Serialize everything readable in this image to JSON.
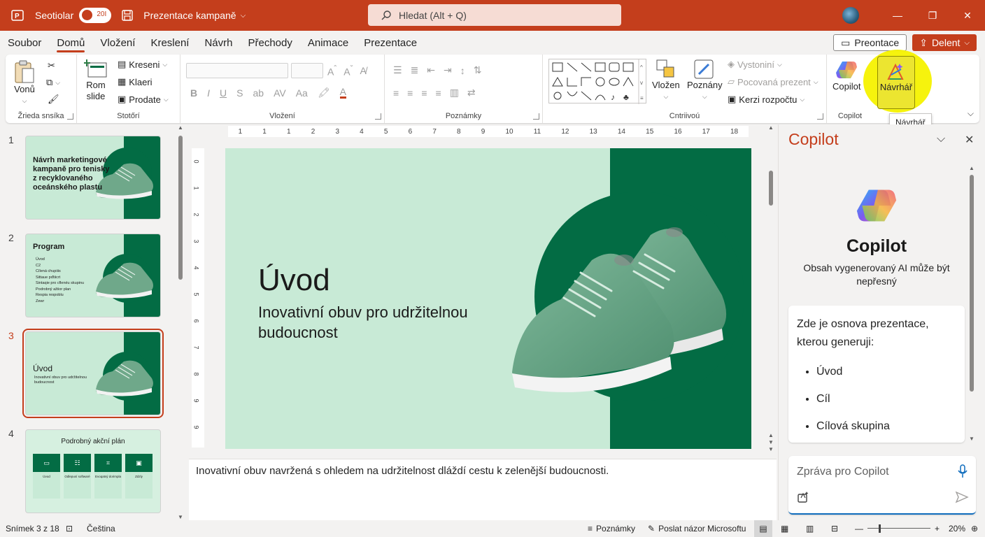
{
  "titlebar": {
    "autosave_label": "Seotiolar",
    "toggle_label": "20І",
    "doc_title": "Prezentace kampaně",
    "search_placeholder": "Hledat (Alt + Q)"
  },
  "menu": {
    "items": [
      "Soubor",
      "Domů",
      "Vložení",
      "Kreslení",
      "Návrh",
      "Přechody",
      "Animace",
      "Prezentace"
    ],
    "active": "Domů",
    "present_button": "Preontace",
    "share_button": "Delent"
  },
  "ribbon": {
    "groups": {
      "clipboard": {
        "label": "Žrieda snsíka",
        "paste": "Vonů"
      },
      "slides": {
        "label": "Stotőrí",
        "new_slide_line1": "Rom",
        "new_slide_line2": "slide",
        "layout": "Kreseni",
        "reset": "Klaeri",
        "section": "Prodate"
      },
      "font": {
        "label": "Vložení"
      },
      "paragraph": {
        "label": "Poznámky"
      },
      "drawing": {
        "label": "Cntriivoú",
        "arrange": "Vložen",
        "quick_styles": "Poznány",
        "fill": "Vystoniní",
        "outline": "Pocovaná prezent",
        "effects": "Kerzi rozpočtu"
      },
      "copilot": {
        "label": "Copilot",
        "button": "Copilot"
      },
      "designer": {
        "button": "Návrhář"
      }
    },
    "tooltip": "Návrhář"
  },
  "thumbnails": [
    {
      "number": "1",
      "title": "Návrh marketingové kampaně pro tenisky z recyklovaného oceánského plastu"
    },
    {
      "number": "2",
      "title": "Program",
      "items": [
        "Úvod",
        "C2",
        "Cílená chupiiis",
        "Sittaue pďtiicrt",
        "Sintaqie pro cflenéu skupinu",
        "Podrobný ažiior plan",
        "Respia respoblu",
        "Zewr"
      ]
    },
    {
      "number": "3",
      "title": "Úvod",
      "subtitle": "Inovativní obuv pro udržitelnou budoucnost"
    },
    {
      "number": "4",
      "title": "Podrobný akční plán",
      "cards": [
        {
          "title": "Úvod"
        },
        {
          "title": "Odlepusí softwaré"
        },
        {
          "title": "Evoqatsý dorimpla"
        },
        {
          "title": "Zdzly"
        }
      ]
    }
  ],
  "active_slide": 3,
  "ruler": {
    "horizontal": [
      "1",
      "1",
      "1",
      "2",
      "3",
      "4",
      "5",
      "6",
      "7",
      "8",
      "9",
      "10",
      "11",
      "12",
      "13",
      "14",
      "15",
      "16",
      "17",
      "18"
    ],
    "vertical": [
      "0",
      "1",
      "2",
      "3",
      "4",
      "5",
      "6",
      "7",
      "8",
      "9",
      "9"
    ]
  },
  "slide": {
    "title": "Úvod",
    "subtitle": "Inovativní obuv pro udržitelnou budoucnost"
  },
  "notes": "Inovativní obuv navržená s ohledem na udržitelnost dláždí cestu k zelenější budoucnosti.",
  "copilot": {
    "pane_title": "Copilot",
    "name": "Copilot",
    "disclaimer": "Obsah vygenerovaný AI může být nepřesný",
    "message_intro": "Zde je osnova prezentace, kterou generuji:",
    "outline": [
      "Úvod",
      "Cíl",
      "Cílová skupina"
    ],
    "input_placeholder": "Zpráva pro Copilot"
  },
  "statusbar": {
    "slide_count": "Snímek 3 z 18",
    "language": "Čeština",
    "notes": "Poznámky",
    "feedback": "Poslat názor Microsoftu",
    "zoom": "20%"
  },
  "colors": {
    "accent": "#c43e1c",
    "slide_bg": "#c8ead6",
    "slide_green": "#036c44",
    "highlight": "#f5f200"
  }
}
